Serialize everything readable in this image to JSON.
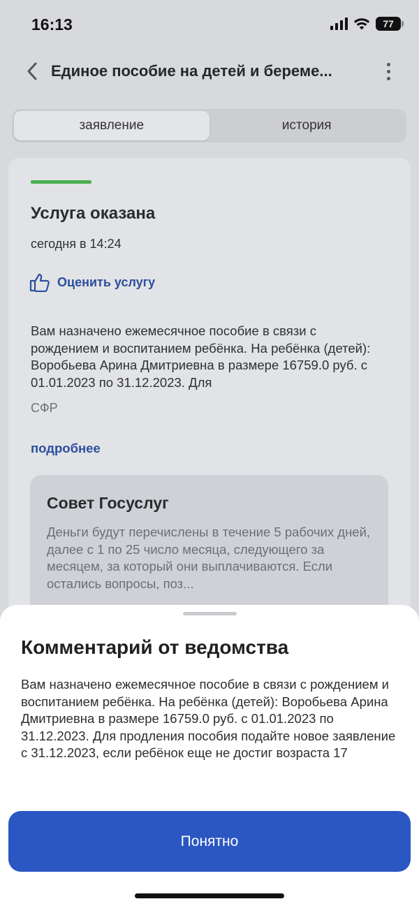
{
  "status_bar": {
    "time": "16:13",
    "battery": "77",
    "icons": [
      "signal-icon",
      "wifi-icon",
      "battery-icon"
    ]
  },
  "header": {
    "title": "Единое пособие на детей и береме...",
    "back_icon": "chevron-left-icon",
    "menu_icon": "more-vertical-icon"
  },
  "tabs": [
    {
      "label": "заявление",
      "active": true
    },
    {
      "label": "история",
      "active": false
    }
  ],
  "card": {
    "status_color": "#4caf50",
    "status_title": "Услуга оказана",
    "status_date": "сегодня в 14:24",
    "rate_label": "Оценить услугу",
    "rate_icon": "thumbs-up-icon",
    "body": "Вам назначено ежемесячное пособие в связи с рождением и воспитанием ребёнка. На ребёнка (детей): Воробьева Арина Дмитриевна в размере 16759.0 руб. с 01.01.2023 по 31.12.2023. Для",
    "org": "СФР",
    "more_link": "подробнее"
  },
  "advice": {
    "title": "Совет Госуслуг",
    "text": "Деньги будут перечислены в течение 5 рабочих дней, далее с 1 по 25 число месяца, следующего за месяцем, за который они выплачиваются. Если остались вопросы, поз..."
  },
  "sheet": {
    "title": "Комментарий от ведомства",
    "text": "Вам назначено ежемесячное пособие в связи с рождением и воспитанием ребёнка. На ребёнка (детей): Воробьева Арина Дмитриевна в размере 16759.0 руб. с 01.01.2023 по 31.12.2023. Для продления пособия подайте новое заявление с 31.12.2023, если ребёнок еще не достиг возраста 17",
    "button_label": "Понятно"
  },
  "colors": {
    "accent": "#2b57c3",
    "link": "#2c4f9e",
    "success": "#4caf50"
  }
}
